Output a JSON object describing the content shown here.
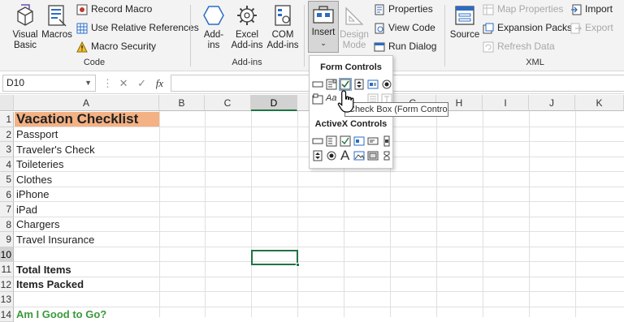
{
  "ribbon": {
    "code": {
      "label": "Code",
      "visual_basic": "Visual\nBasic",
      "visual_basic_l1": "Visual",
      "visual_basic_l2": "Basic",
      "macros": "Macros",
      "record_macro": "Record Macro",
      "use_relative_refs": "Use Relative References",
      "macro_security": "Macro Security"
    },
    "addins": {
      "label": "Add-ins",
      "addins_l1": "Add-",
      "addins_l2": "ins",
      "excel_addins_l1": "Excel",
      "excel_addins_l2": "Add-ins",
      "com_addins_l1": "COM",
      "com_addins_l2": "Add-ins"
    },
    "controls": {
      "insert": "Insert",
      "design_mode_l1": "Design",
      "design_mode_l2": "Mode",
      "properties": "Properties",
      "view_code": "View Code",
      "run_dialog": "Run Dialog"
    },
    "xml": {
      "label": "XML",
      "source": "Source",
      "map_properties": "Map Properties",
      "expansion_packs": "Expansion Packs",
      "refresh_data": "Refresh Data",
      "import": "Import",
      "export": "Export"
    }
  },
  "formula_bar": {
    "name_box": "D10",
    "fx": "fx",
    "value": ""
  },
  "dropdown": {
    "form_controls_title": "Form Controls",
    "activex_title": "ActiveX Controls",
    "tooltip": "Check Box (Form Control)",
    "partial_label": "Aa"
  },
  "sheet": {
    "columns": [
      "A",
      "B",
      "C",
      "D",
      "E",
      "F",
      "G",
      "H",
      "I",
      "J",
      "K"
    ],
    "selected_column": "D",
    "rows": [
      "1",
      "2",
      "3",
      "4",
      "5",
      "6",
      "7",
      "8",
      "9",
      "10",
      "11",
      "12",
      "13",
      "14"
    ],
    "selected_row": "10",
    "cells": {
      "a1": "Vacation Checklist",
      "a2": "Passport",
      "a3": "Traveler's Check",
      "a4": "Toileteries",
      "a5": "Clothes",
      "a6": "iPhone",
      "a7": "iPad",
      "a8": "Chargers",
      "a9": "Travel Insurance",
      "a11": "Total Items",
      "a12": "Items Packed",
      "a14": "Am I Good to Go?"
    }
  },
  "colors": {
    "accent_green": "#217346",
    "header_fill": "#f4b183",
    "good_to_go_text": "#3a9a3a"
  }
}
